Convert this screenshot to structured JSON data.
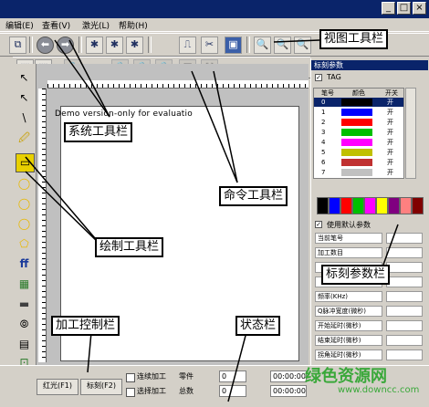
{
  "menu": {
    "items": [
      "编辑(E)",
      "查看(V)",
      "激光(L)",
      "帮助(H)"
    ]
  },
  "window": {
    "controls": [
      "_",
      "□",
      "×"
    ]
  },
  "system_toolbar": {
    "buttons": [
      "⧉",
      "⬅",
      "➡",
      "✱",
      "✱",
      "✱",
      "⎍",
      "✂",
      "▣"
    ]
  },
  "view_toolbar": {
    "buttons": [
      "🔍",
      "🔍",
      "🔍"
    ]
  },
  "command_toolbar": {
    "buttons": [
      "⬚",
      "⬚",
      "🔒",
      "🔒",
      "🔒",
      "🔒",
      "⚿",
      "⛶"
    ]
  },
  "drawing_tools": {
    "buttons": [
      "↖",
      "↖",
      "\\",
      "🖉",
      "▭",
      "◯",
      "◯",
      "◯",
      "⬠",
      "ff",
      "▦",
      "▬",
      "⦾",
      "▤",
      "⊡"
    ]
  },
  "canvas": {
    "demo_text": "Demo version-only for evaluatio"
  },
  "right_panel": {
    "title": "标刻参数",
    "tag_label": "TAG",
    "headers": [
      "笔号",
      "颜色",
      "开关"
    ],
    "pens": [
      {
        "no": "0",
        "color": "#000000",
        "state": "开"
      },
      {
        "no": "1",
        "color": "#0000ff",
        "state": "开"
      },
      {
        "no": "2",
        "color": "#ff0000",
        "state": "开"
      },
      {
        "no": "3",
        "color": "#00c000",
        "state": "开"
      },
      {
        "no": "4",
        "color": "#ff00ff",
        "state": "开"
      },
      {
        "no": "5",
        "color": "#c0c000",
        "state": "开"
      },
      {
        "no": "6",
        "color": "#c03030",
        "state": "开"
      },
      {
        "no": "7",
        "color": "#c0c0c0",
        "state": "开"
      }
    ],
    "palette": [
      "#000000",
      "#0000ff",
      "#ff0000",
      "#00c000",
      "#ff00ff",
      "#ffff00",
      "#800080",
      "#ff8080",
      "#800000"
    ],
    "default_param_label": "使用默认参数",
    "params": [
      "当前笔号",
      "加工数目",
      "",
      "",
      "频率(KHz)",
      "Q脉冲宽度(微秒)",
      "开始延时(微秒)",
      "结束延时(微秒)",
      "拐角延时(微秒)"
    ]
  },
  "bottom": {
    "red_btn": "红光(F1)",
    "mark_btn": "标刻(F2)",
    "continuous": "连续加工",
    "selected": "选择加工",
    "part_label": "零件",
    "total_label": "总数",
    "part_value": "0",
    "total_value": "0",
    "time1": "00:00:00",
    "time2": "00:00:00"
  },
  "callouts": {
    "view": "视图工具栏",
    "system": "系统工具栏",
    "command": "命令工具栏",
    "draw": "绘制工具栏",
    "mark_param": "标刻参数栏",
    "process": "加工控制栏",
    "status": "状态栏"
  },
  "watermark": {
    "line1": "绿色资源网",
    "line2": "www.downcc.com"
  }
}
